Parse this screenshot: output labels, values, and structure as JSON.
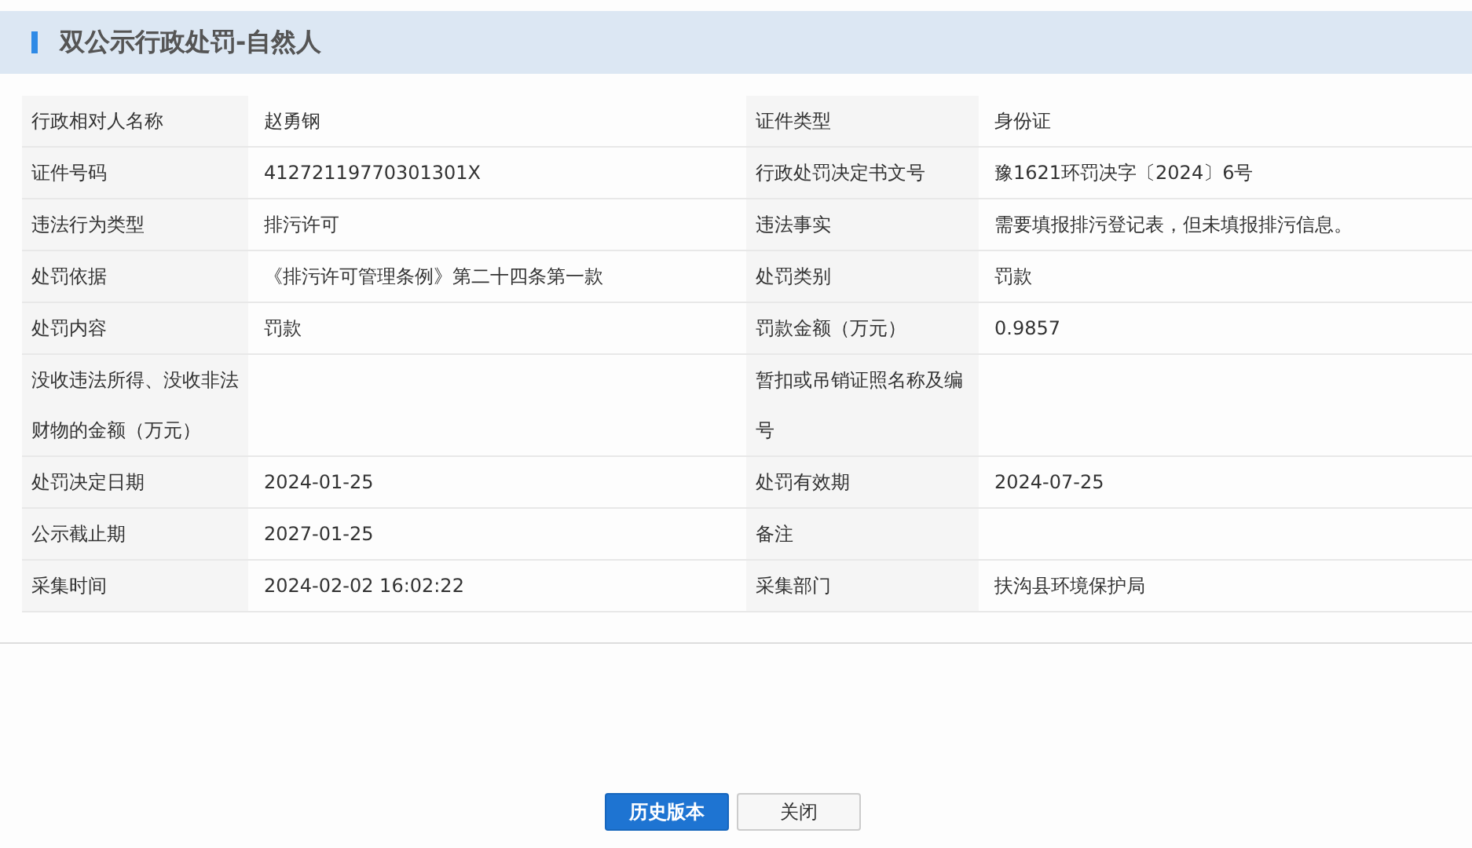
{
  "title": "双公示行政处罚-自然人",
  "rows": [
    {
      "cells": [
        {
          "label": "行政相对人名称",
          "value": "赵勇钢"
        },
        {
          "label": "证件类型",
          "value": "身份证"
        }
      ]
    },
    {
      "cells": [
        {
          "label": "证件号码",
          "value": "41272119770301301X"
        },
        {
          "label": "行政处罚决定书文号",
          "value": "豫1621环罚决字〔2024〕6号"
        }
      ]
    },
    {
      "cells": [
        {
          "label": "违法行为类型",
          "value": "排污许可"
        },
        {
          "label": "违法事实",
          "value": "需要填报排污登记表，但未填报排污信息。"
        }
      ]
    },
    {
      "cells": [
        {
          "label": "处罚依据",
          "value": "《排污许可管理条例》第二十四条第一款"
        },
        {
          "label": "处罚类别",
          "value": "罚款"
        }
      ]
    },
    {
      "cells": [
        {
          "label": "处罚内容",
          "value": "罚款"
        },
        {
          "label": "罚款金额（万元）",
          "value": "0.9857"
        }
      ]
    },
    {
      "cells": [
        {
          "label": "没收违法所得、没收非法财物的金额（万元）"
        },
        {
          "label": "暂扣或吊销证照名称及编号"
        }
      ]
    },
    {
      "cells": [
        {
          "label": "处罚决定日期",
          "value": "2024-01-25"
        },
        {
          "label": "处罚有效期",
          "value": "2024-07-25"
        }
      ]
    },
    {
      "cells": [
        {
          "label": "公示截止期",
          "value": "2027-01-25"
        },
        {
          "label": "备注"
        }
      ]
    },
    {
      "cells": [
        {
          "label": "采集时间",
          "value": "2024-02-02 16:02:22"
        },
        {
          "label": "采集部门",
          "value": "扶沟县环境保护局"
        }
      ]
    }
  ],
  "buttons": [
    {
      "label": "历史版本",
      "kind": "primary"
    },
    {
      "label": "关闭",
      "kind": "default"
    }
  ]
}
